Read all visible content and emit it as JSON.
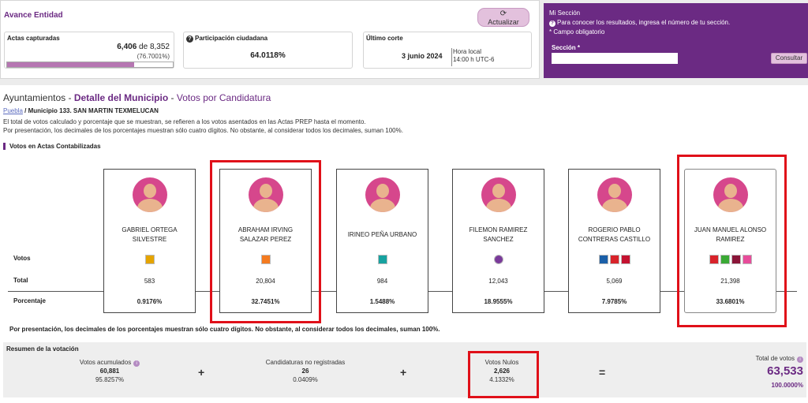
{
  "top": {
    "title": "Avance Entidad",
    "update_label": "Actualizar",
    "update_icon": "refresh-icon",
    "actas": {
      "label": "Actas capturadas",
      "captured": "6,406",
      "of_text": " de ",
      "total": "8,352",
      "pct_text": "(76.7001%)",
      "progress_percent": 76.7001
    },
    "participacion": {
      "label": "Participación ciudadana",
      "value": "64.0118%"
    },
    "corte": {
      "label": "Último corte",
      "date": "3 junio 2024",
      "time_label": "Hora local",
      "time": "14:00 h UTC-6"
    }
  },
  "seccion": {
    "title": "Mi Sección",
    "info": "Para conocer los resultados, ingresa el número de tu sección.",
    "required_note": "* Campo obligatorio",
    "field_label": "Sección *",
    "input_value": "",
    "button": "Consultar"
  },
  "main": {
    "heading_prefix": "Ayuntamientos - ",
    "heading_detail": "Detalle del Municipio",
    "heading_sep": " - ",
    "heading_votes": "Votos por Candidatura",
    "breadcrumb_link": "Puebla",
    "breadcrumb_rest": " / Municipio 133. SAN MARTIN TEXMELUCAN",
    "note1": "El total de votos calculado y porcentaje que se muestran, se refieren a los votos asentados en las Actas PREP hasta el momento.",
    "note2": "Por presentación, los decimales de los porcentajes muestran sólo cuatro dígitos. No obstante, al considerar todos los decimales, suman 100%.",
    "votes_title": "Votos en Actas Contabilizadas",
    "row_labels": {
      "votos": "Votos",
      "total": "Total",
      "porcentaje": "Porcentaje"
    },
    "footnote": "Por presentación, los decimales de los porcentajes muestran sólo cuatro dígitos. No obstante, al considerar todos los decimales, suman 100%."
  },
  "candidates": [
    {
      "name_line1": "GABRIEL ORTEGA",
      "name_line2": "SILVESTRE",
      "total": "583",
      "percent": "0.9176%",
      "parties": [
        {
          "icon": "party-logo-icon",
          "color": "#e5a400"
        }
      ]
    },
    {
      "name_line1": "ABRAHAM IRVING",
      "name_line2": "SALAZAR PEREZ",
      "total": "20,804",
      "percent": "32.7451%",
      "parties": [
        {
          "icon": "party-logo-icon",
          "color": "#f47b20"
        }
      ]
    },
    {
      "name_line1": "IRINEO PEÑA URBANO",
      "name_line2": "",
      "total": "984",
      "percent": "1.5488%",
      "parties": [
        {
          "icon": "party-logo-icon",
          "color": "#17a2a0"
        }
      ]
    },
    {
      "name_line1": "FILEMON RAMIREZ",
      "name_line2": "SANCHEZ",
      "total": "12,043",
      "percent": "18.9555%",
      "parties": [
        {
          "icon": "party-logo-icon",
          "color": "#7a3a9a"
        }
      ]
    },
    {
      "name_line1": "ROGERIO PABLO",
      "name_line2": "CONTRERAS CASTILLO",
      "total": "5,069",
      "percent": "7.9785%",
      "parties": [
        {
          "icon": "party-logo-icon",
          "color": "#1a5fa8"
        },
        {
          "icon": "party-logo-icon",
          "color": "#d8232a"
        },
        {
          "icon": "party-logo-icon",
          "color": "#c41230"
        }
      ]
    },
    {
      "name_line1": "JUAN MANUEL ALONSO",
      "name_line2": "RAMIREZ",
      "total": "21,398",
      "percent": "33.6801%",
      "parties": [
        {
          "icon": "party-logo-icon",
          "color": "#d8232a"
        },
        {
          "icon": "party-logo-icon",
          "color": "#3aa935"
        },
        {
          "icon": "party-logo-icon",
          "color": "#8a1538"
        },
        {
          "icon": "party-logo-icon",
          "color": "#e74c9a"
        }
      ]
    }
  ],
  "summary": {
    "title": "Resumen de la votación",
    "acumulados": {
      "label": "Votos acumulados",
      "value": "60,881",
      "pct": "95.8257%"
    },
    "no_registradas": {
      "label": "Candidaturas no registradas",
      "value": "26",
      "pct": "0.0409%"
    },
    "nulos": {
      "label": "Votos Nulos",
      "value": "2,626",
      "pct": "4.1332%"
    },
    "plus": "+",
    "equals": "=",
    "total": {
      "label": "Total de votos",
      "value": "63,533",
      "pct": "100.0000%"
    }
  },
  "colors": {
    "brand": "#6b2a83",
    "highlight": "#e01019",
    "avatar": "#d6478c"
  }
}
